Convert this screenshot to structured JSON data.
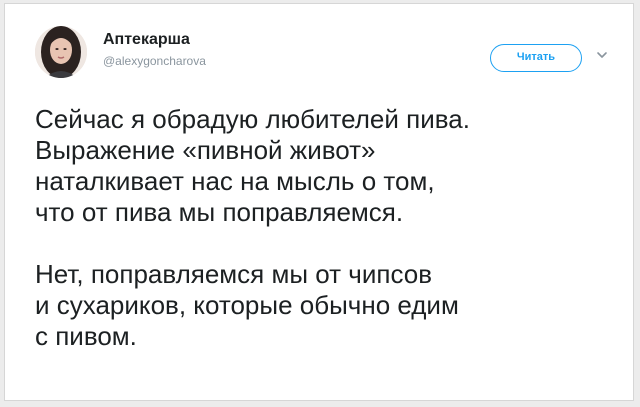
{
  "tweet": {
    "author": {
      "display_name": "Аптекарша",
      "handle": "@alexygoncharova",
      "avatar_icon": "avatar-photo"
    },
    "follow_label": "Читать",
    "menu_icon": "chevron-down-icon",
    "accent_color": "#1da1f2",
    "text_color": "#1c2022",
    "paragraphs": [
      {
        "lines": [
          "Сейчас я обрадую любителей пива.",
          "Выражение «пивной живот»",
          "наталкивает нас на мысль о том,",
          "что от пива мы поправляемся."
        ]
      },
      {
        "lines": [
          "Нет, поправляемся мы от чипсов",
          "и сухариков, которые обычно едим",
          "с пивом."
        ]
      }
    ]
  }
}
